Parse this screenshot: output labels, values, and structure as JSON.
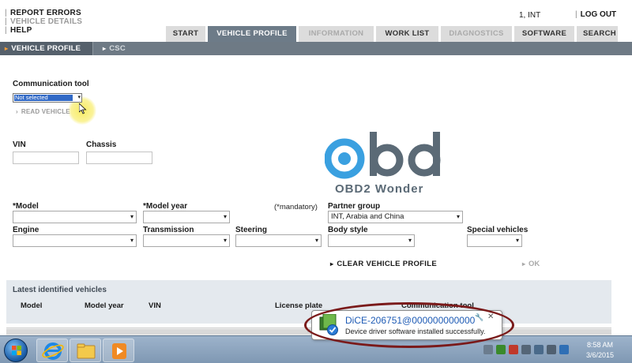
{
  "header": {
    "links": [
      {
        "label": "REPORT ERRORS",
        "dim": false
      },
      {
        "label": "VEHICLE DETAILS",
        "dim": true
      },
      {
        "label": "HELP",
        "dim": false
      }
    ],
    "user": "1, INT",
    "logout_label": "LOG OUT"
  },
  "main_tabs": [
    {
      "label": "START",
      "state": "normal"
    },
    {
      "label": "VEHICLE PROFILE",
      "state": "active"
    },
    {
      "label": "INFORMATION",
      "state": "disabled"
    },
    {
      "label": "WORK LIST",
      "state": "normal"
    },
    {
      "label": "DIAGNOSTICS",
      "state": "disabled"
    },
    {
      "label": "SOFTWARE",
      "state": "normal"
    },
    {
      "label": "SEARCH",
      "state": "normal"
    }
  ],
  "sub_tabs": {
    "active": "VEHICLE PROFILE",
    "inactive": "CSC"
  },
  "form": {
    "comm_tool_label": "Communication tool",
    "comm_tool_value": "Not selected",
    "read_vehicle_label": "READ VEHICLE",
    "vin_label": "VIN",
    "chassis_label": "Chassis",
    "model_label": "*Model",
    "model_year_label": "*Model year",
    "mandatory_note": "(*mandatory)",
    "partner_group_label": "Partner group",
    "partner_group_value": "INT, Arabia and China",
    "engine_label": "Engine",
    "transmission_label": "Transmission",
    "steering_label": "Steering",
    "body_style_label": "Body style",
    "special_vehicles_label": "Special vehicles",
    "clear_label": "CLEAR VEHICLE PROFILE",
    "ok_label": "OK"
  },
  "watermark": {
    "text": "OBD2 Wonder"
  },
  "latest": {
    "title": "Latest identified vehicles",
    "columns": [
      "Model",
      "Model year",
      "VIN",
      "License plate",
      "Communication tool"
    ]
  },
  "notification": {
    "title": "DiCE-206751@000000000000",
    "message": "Device driver software installed successfully."
  },
  "taskbar": {
    "time": "8:58 AM",
    "date": "3/6/2015"
  },
  "colors": {
    "tab_active": "#6d7b88",
    "subnav": "#6e7a85",
    "accent_orange": "#f29c38",
    "selection_blue": "#3169c6",
    "watermark_blue": "#3aa0e0"
  }
}
